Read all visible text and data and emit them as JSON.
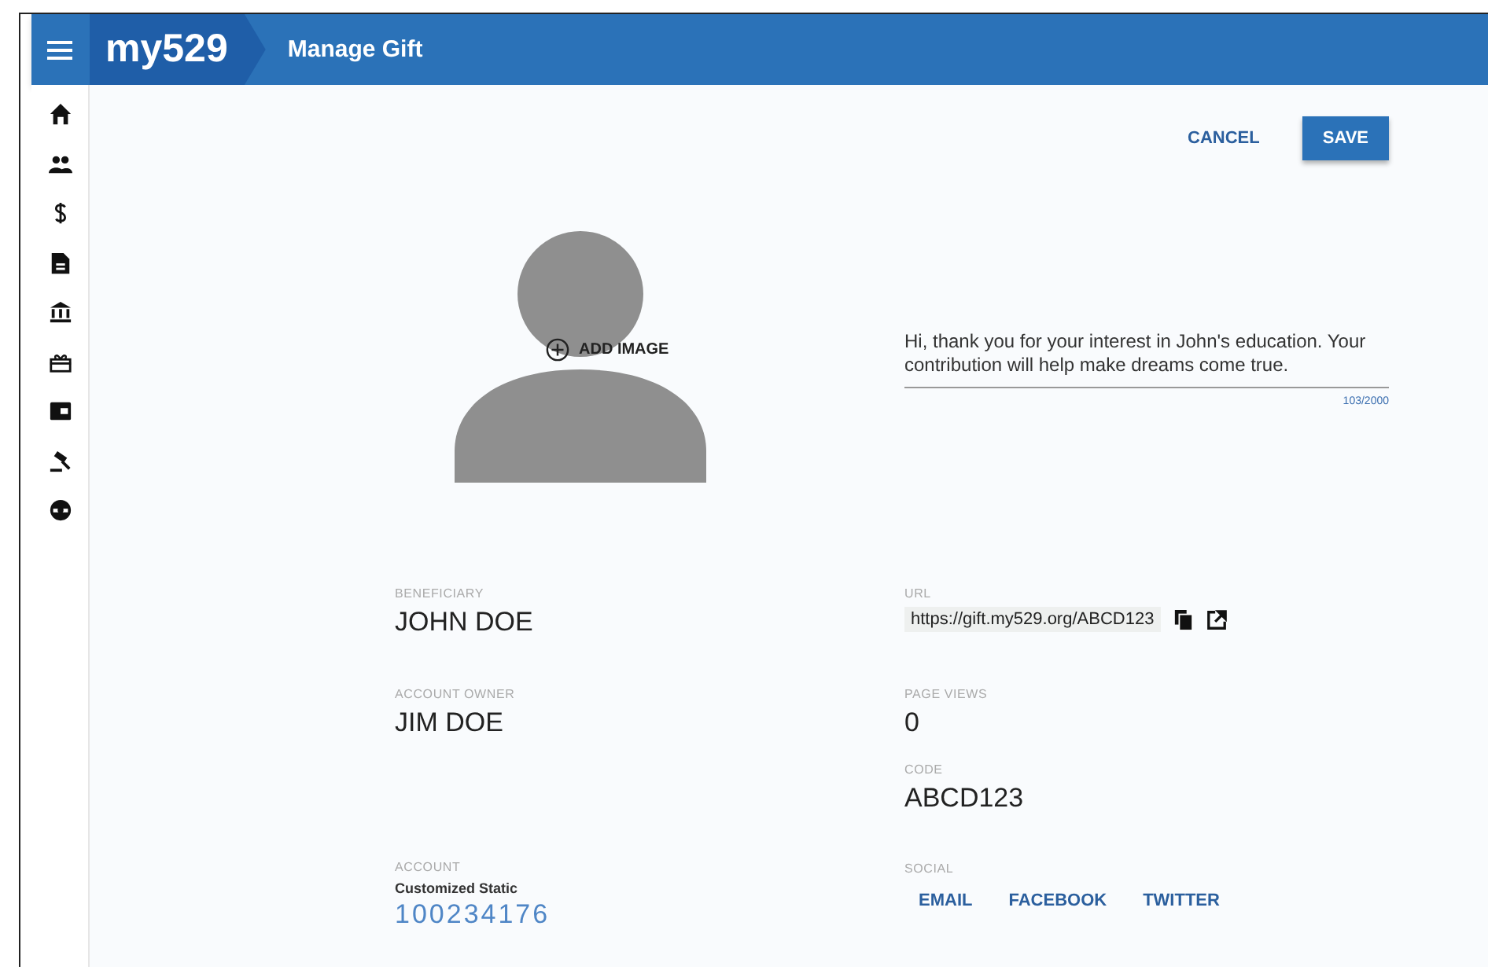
{
  "header": {
    "logo": "my529",
    "title": "Manage Gift"
  },
  "sidebar": {
    "items": [
      {
        "kind": "home"
      },
      {
        "kind": "people"
      },
      {
        "kind": "dollar"
      },
      {
        "kind": "document"
      },
      {
        "kind": "bank"
      },
      {
        "kind": "gift"
      },
      {
        "kind": "wallet"
      },
      {
        "kind": "gavel"
      },
      {
        "kind": "support"
      }
    ]
  },
  "actions": [
    {
      "label": "CANCEL",
      "kind": "text"
    },
    {
      "label": "SAVE",
      "kind": "raised"
    }
  ],
  "avatar": {
    "add_label": "ADD IMAGE"
  },
  "message": {
    "value": "Hi, thank you for your interest in John's education. Your contribution will help make dreams come true.",
    "counter": "103/2000"
  },
  "details_left": [
    {
      "label": "BENEFICIARY",
      "value": "JOHN DOE",
      "kind": "name"
    },
    {
      "label": "ACCOUNT OWNER",
      "value": "JIM DOE",
      "kind": "name"
    },
    {
      "label": "ACCOUNT",
      "subtitle": "Customized Static",
      "value": "100234176",
      "kind": "account"
    }
  ],
  "details_right": [
    {
      "label": "URL",
      "value": "https://gift.my529.org/ABCD123",
      "kind": "url"
    },
    {
      "label": "PAGE VIEWS",
      "value": "0",
      "kind": "plain"
    },
    {
      "label": "CODE",
      "value": "ABCD123",
      "kind": "plain"
    },
    {
      "label": "SOCIAL",
      "links": [
        "EMAIL",
        "FACEBOOK",
        "TWITTER"
      ],
      "kind": "links"
    }
  ]
}
